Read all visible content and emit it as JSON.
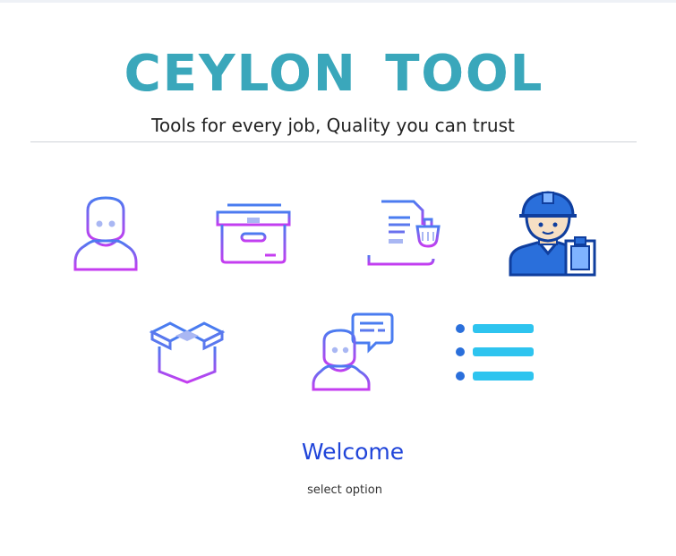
{
  "header": {
    "title": "CEYLON  TOOL",
    "tagline": "Tools for every job, Quality you can trust"
  },
  "menu": {
    "items": [
      {
        "icon": "user-icon"
      },
      {
        "icon": "archive-box-icon"
      },
      {
        "icon": "invoice-document-icon"
      },
      {
        "icon": "worker-clipboard-icon"
      },
      {
        "icon": "open-box-icon"
      },
      {
        "icon": "user-chat-icon"
      },
      {
        "icon": "list-icon"
      }
    ]
  },
  "main": {
    "welcome": "Welcome",
    "instruction": "select option"
  },
  "colors": {
    "title": "#3aa7bb",
    "icon_gradient_top": "#4a7cf0",
    "icon_gradient_bottom": "#c53df0",
    "worker_blue": "#2a6fdb",
    "list_cyan": "#2ec4ef",
    "welcome": "#1f44d9"
  }
}
